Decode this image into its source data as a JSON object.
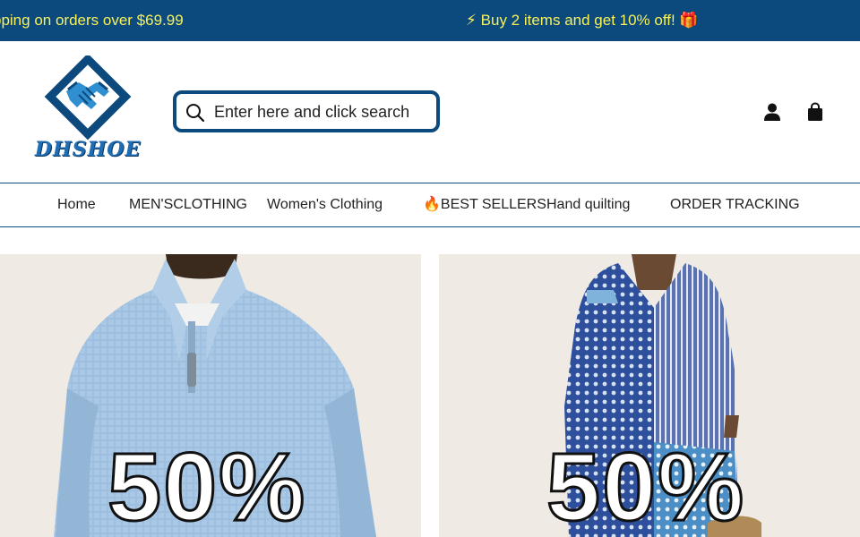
{
  "announcement": {
    "messages": [
      "pping on orders over $69.99",
      "⚡ Buy 2 items and get 10% off! 🎁"
    ]
  },
  "header": {
    "logo_text": "DHSHOE",
    "search_placeholder": "Enter here and click search"
  },
  "nav": {
    "items": [
      "Home",
      "MEN'SCLOTHING",
      "Women's Clothing",
      "🔥BEST SELLERS",
      "Hand quilting",
      "ORDER TRACKING"
    ]
  },
  "banners": [
    {
      "text": "50%"
    },
    {
      "text": "50%"
    }
  ],
  "colors": {
    "brand": "#0c4a7e",
    "announcement_text": "#f7f15a",
    "banner_bg": "#efebe4"
  }
}
